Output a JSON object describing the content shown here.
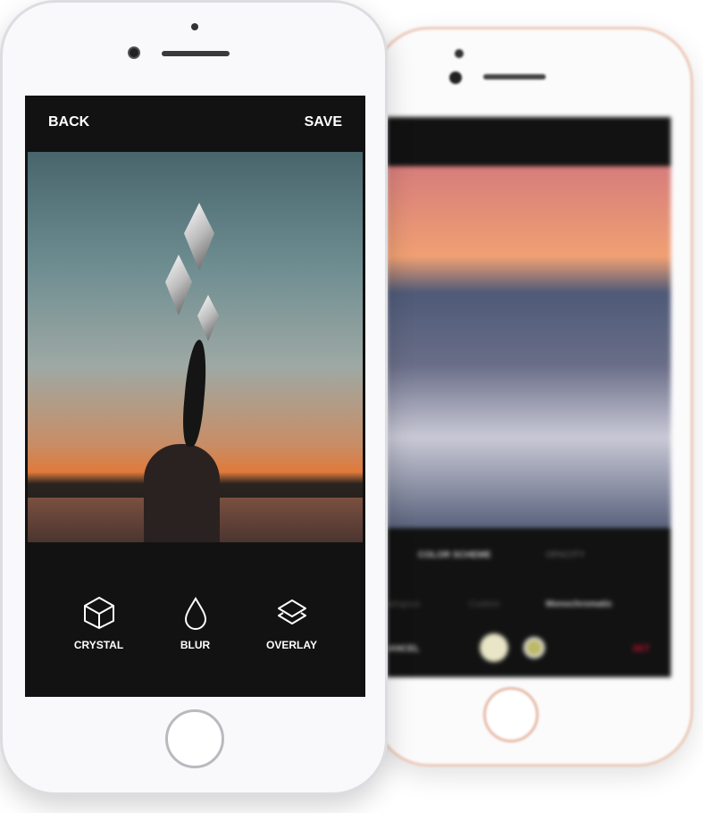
{
  "front": {
    "header": {
      "back_label": "BACK",
      "save_label": "SAVE"
    },
    "tools": [
      {
        "label": "CRYSTAL",
        "icon": "cube-icon"
      },
      {
        "label": "BLUR",
        "icon": "drop-icon"
      },
      {
        "label": "OVERLAY",
        "icon": "layers-icon"
      }
    ]
  },
  "back": {
    "tabs": [
      "COLOR SCHEME",
      "OPACITY"
    ],
    "schemes": [
      "Analogous",
      "Custom",
      "Monochromatic"
    ],
    "cancel_label": "CANCEL",
    "set_label": "SET",
    "colors": {
      "set": "#c8102e",
      "swatch1": "#e9e6c8",
      "swatch2": "#bdb86a"
    }
  }
}
